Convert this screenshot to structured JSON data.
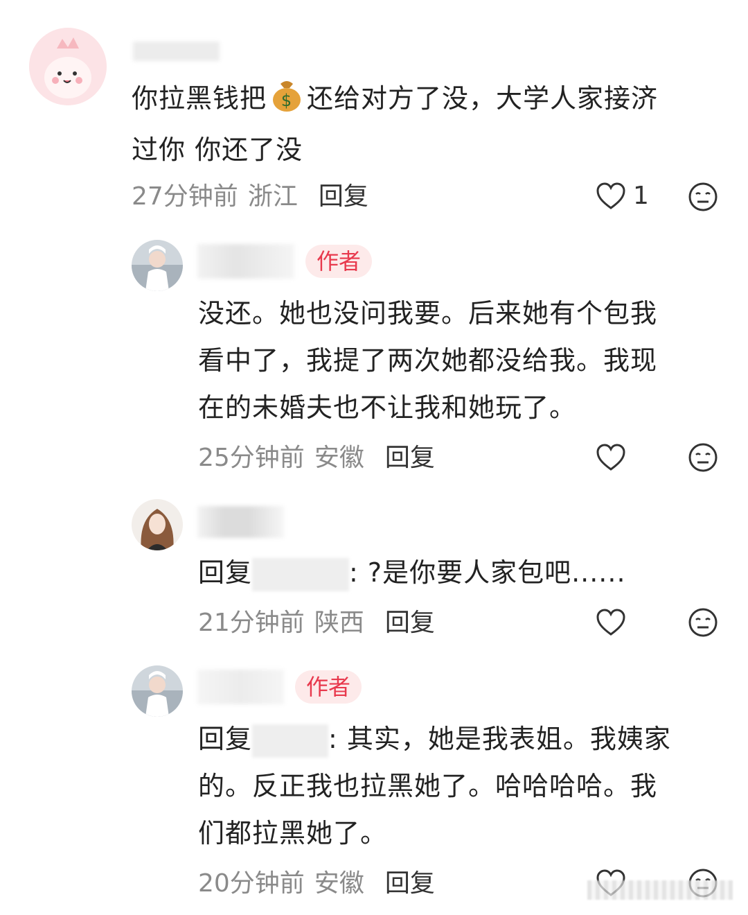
{
  "comments": [
    {
      "text_before": "你拉黑钱把",
      "emoji": "money-bag",
      "text_after": "还给对方了没，大学人家接济",
      "text_line2": "过你  你还了没",
      "time": "27分钟前",
      "region": "浙江",
      "reply_label": "回复",
      "like_count": "1"
    },
    {
      "badge": "作者",
      "lines": [
        "没还。她也没问我要。后来她有个包我",
        "看中了，我提了两次她都没给我。我现",
        "在的未婚夫也不让我和她玩了。"
      ],
      "time": "25分钟前",
      "region": "安徽",
      "reply_label": "回复"
    },
    {
      "reply_prefix": "回复",
      "text": ": ?是你要人家包吧......",
      "time": "21分钟前",
      "region": "陕西",
      "reply_label": "回复"
    },
    {
      "badge": "作者",
      "reply_prefix": "回复",
      "line1": ": 其实，她是我表姐。我姨家",
      "lines": [
        "的。反正我也拉黑她了。哈哈哈哈。我",
        "们都拉黑她了。"
      ],
      "time": "20分钟前",
      "region": "安徽",
      "reply_label": "回复"
    }
  ],
  "colors": {
    "accent": "#e8394d",
    "badge_bg": "#fdeaea",
    "meta": "#8a8a8a"
  },
  "icons": [
    "heart-icon",
    "meh-face-icon",
    "money-bag-icon"
  ]
}
